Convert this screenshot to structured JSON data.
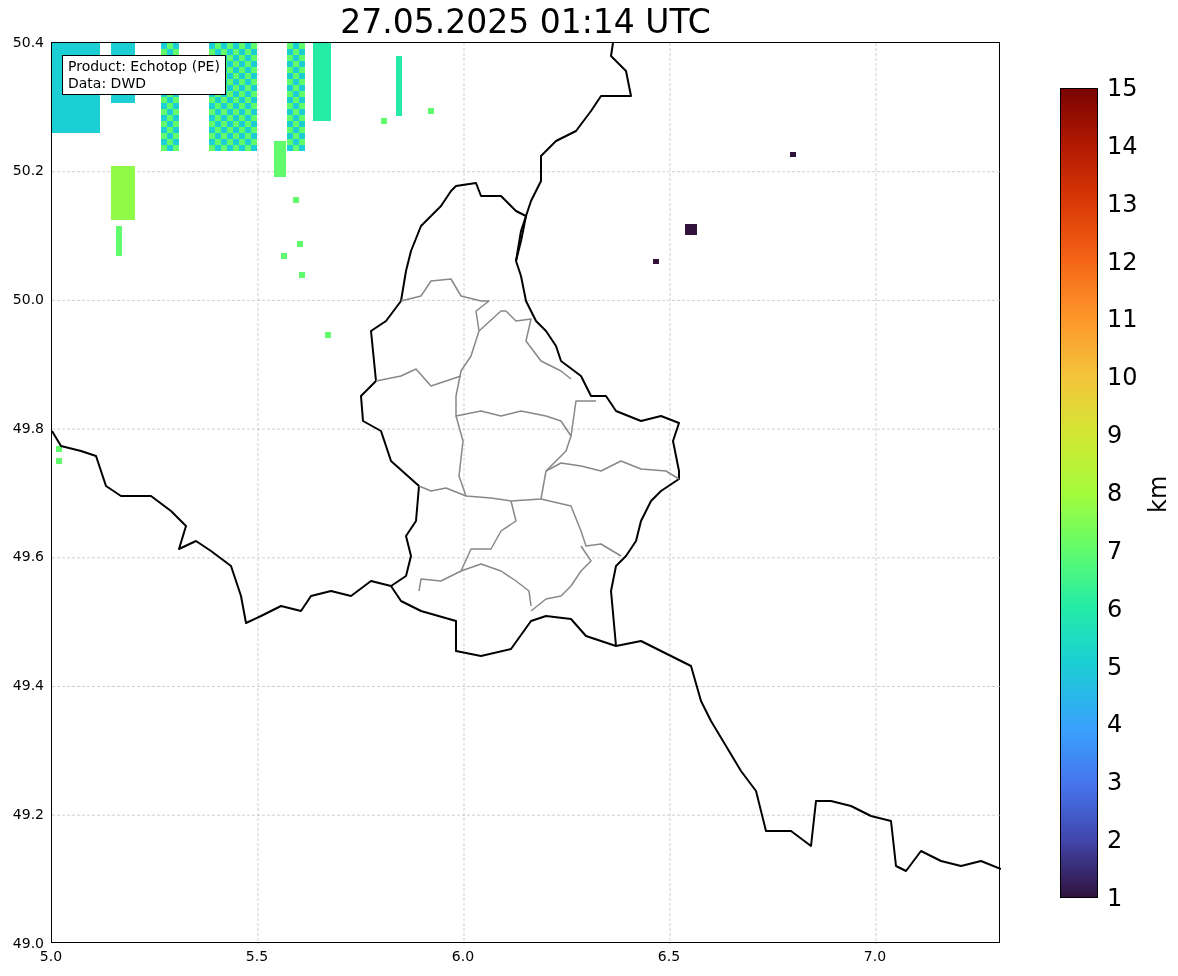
{
  "title": "27.05.2025 01:14 UTC",
  "info_box": [
    "Product: Echotop (PE)",
    "Data: DWD"
  ],
  "x_ticks": [
    "5.0",
    "5.5",
    "6.0",
    "6.5",
    "7.0"
  ],
  "y_ticks": [
    "50.4",
    "50.2",
    "50.0",
    "49.8",
    "49.6",
    "49.4",
    "49.2",
    "49.0"
  ],
  "colorbar": {
    "label": "km",
    "ticks": [
      "15",
      "14",
      "13",
      "12",
      "11",
      "10",
      "9",
      "8",
      "7",
      "6",
      "5",
      "4",
      "3",
      "2",
      "1"
    ]
  }
}
